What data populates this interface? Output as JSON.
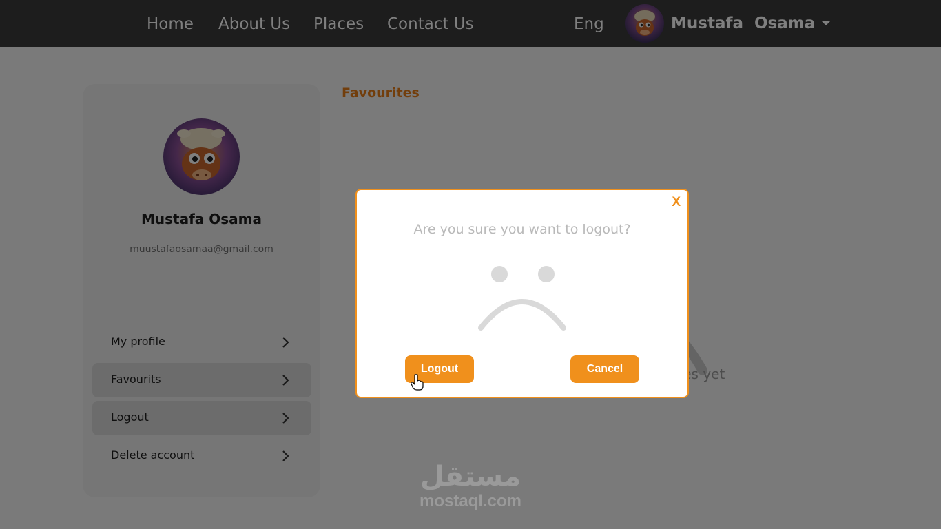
{
  "navbar": {
    "links": [
      "Home",
      "About Us",
      "Places",
      "Contact Us"
    ],
    "language": "Eng",
    "user_name": "Mustafa  Osama"
  },
  "profile": {
    "name": "Mustafa Osama",
    "email": "muustafaosamaa@gmail.com"
  },
  "menu": {
    "items": [
      "My profile",
      "Favourits",
      "Logout",
      "Delete account"
    ]
  },
  "main": {
    "section_title": "Favourites",
    "empty_text": "urites yet"
  },
  "modal": {
    "close_label": "X",
    "question": "Are you sure you want to logout?",
    "logout_label": "Logout",
    "cancel_label": "Cancel"
  },
  "watermark": {
    "arabic": "مستقل",
    "domain": "mostaql.com"
  },
  "colors": {
    "accent": "#f0901c",
    "navbar": "#3a3a3a"
  }
}
